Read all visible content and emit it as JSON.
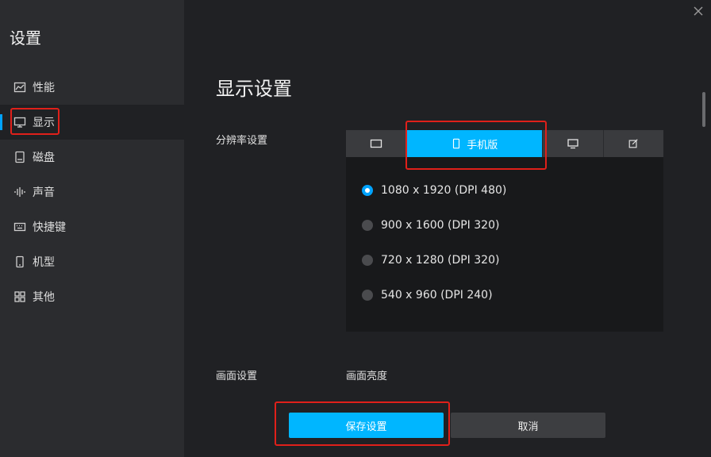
{
  "sidebar": {
    "title": "设置",
    "items": [
      {
        "label": "性能",
        "icon": "chart-icon"
      },
      {
        "label": "显示",
        "icon": "monitor-icon"
      },
      {
        "label": "磁盘",
        "icon": "disk-icon"
      },
      {
        "label": "声音",
        "icon": "sound-icon"
      },
      {
        "label": "快捷键",
        "icon": "keyboard-icon"
      },
      {
        "label": "机型",
        "icon": "phone-icon"
      },
      {
        "label": "其他",
        "icon": "grid-icon"
      }
    ]
  },
  "main": {
    "title": "显示设置",
    "resolution_label": "分辨率设置",
    "tabs": [
      {
        "label": "",
        "icon": "tablet-landscape-icon"
      },
      {
        "label": "手机版",
        "icon": "phone-icon"
      },
      {
        "label": "",
        "icon": "desktop-icon"
      },
      {
        "label": "",
        "icon": "edit-icon"
      }
    ],
    "options": [
      {
        "label": "1080 x 1920 (DPI 480)",
        "selected": true
      },
      {
        "label": "900 x 1600 (DPI 320)",
        "selected": false
      },
      {
        "label": "720 x 1280 (DPI 320)",
        "selected": false
      },
      {
        "label": "540 x 960 (DPI 240)",
        "selected": false
      }
    ],
    "screen_label": "画面设置",
    "brightness_label": "画面亮度"
  },
  "buttons": {
    "save": "保存设置",
    "cancel": "取消"
  },
  "colors": {
    "accent": "#00b6ff",
    "highlight": "#e0201a",
    "background": "#202124",
    "sidebar": "#2b2c2f"
  }
}
